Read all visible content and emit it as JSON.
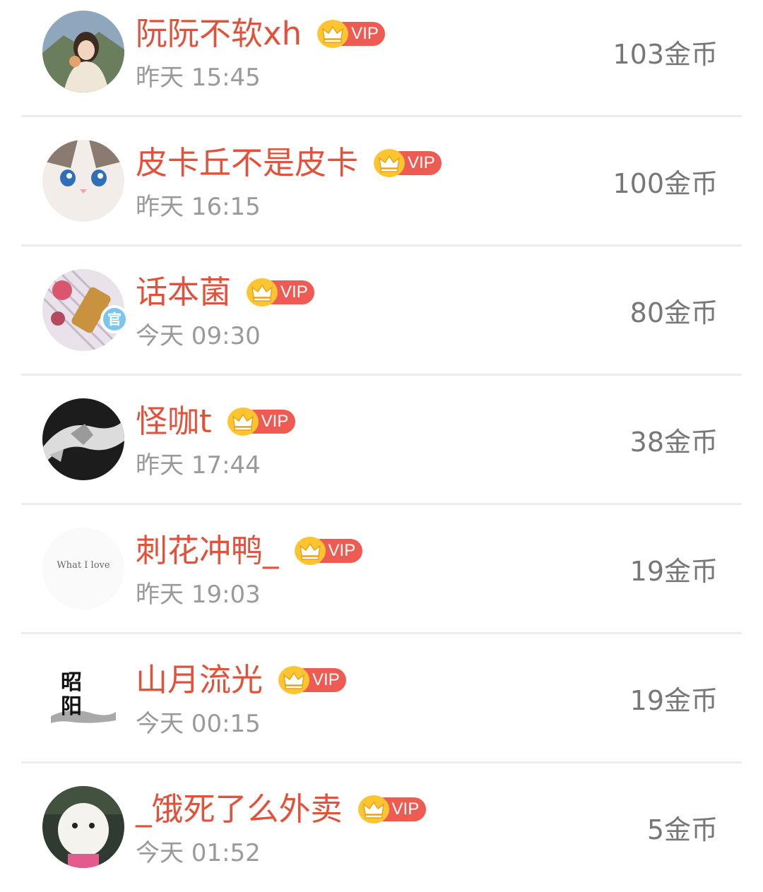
{
  "rows": [
    {
      "name": "阮阮不软xh",
      "vip_label": "VIP",
      "time": "昨天 15:45",
      "coins": "103金币"
    },
    {
      "name": "皮卡丘不是皮卡",
      "vip_label": "VIP",
      "time": "昨天 16:15",
      "coins": "100金币"
    },
    {
      "name": "话本菌",
      "vip_label": "VIP",
      "time": "今天 09:30",
      "coins": "80金币",
      "official_badge": "官"
    },
    {
      "name": "怪咖t",
      "vip_label": "VIP",
      "time": "昨天 17:44",
      "coins": "38金币"
    },
    {
      "name": "刺花冲鸭_",
      "vip_label": "VIP",
      "time": "昨天 19:03",
      "coins": "19金币",
      "avatar_text": "What I love"
    },
    {
      "name": "山月流光",
      "vip_label": "VIP",
      "time": "今天 00:15",
      "coins": "19金币",
      "avatar_text": "昭阳"
    },
    {
      "name": "_饿死了么外卖",
      "vip_label": "VIP",
      "time": "今天 01:52",
      "coins": "5金币"
    }
  ],
  "colors": {
    "name": "#e2523b",
    "vip_pill": "#ee5b52",
    "vip_medal": "#ffc531",
    "time": "#9a9a9a",
    "coins": "#777777",
    "divider": "#ececec"
  },
  "icons": {
    "vip_medal": "crown-icon"
  }
}
